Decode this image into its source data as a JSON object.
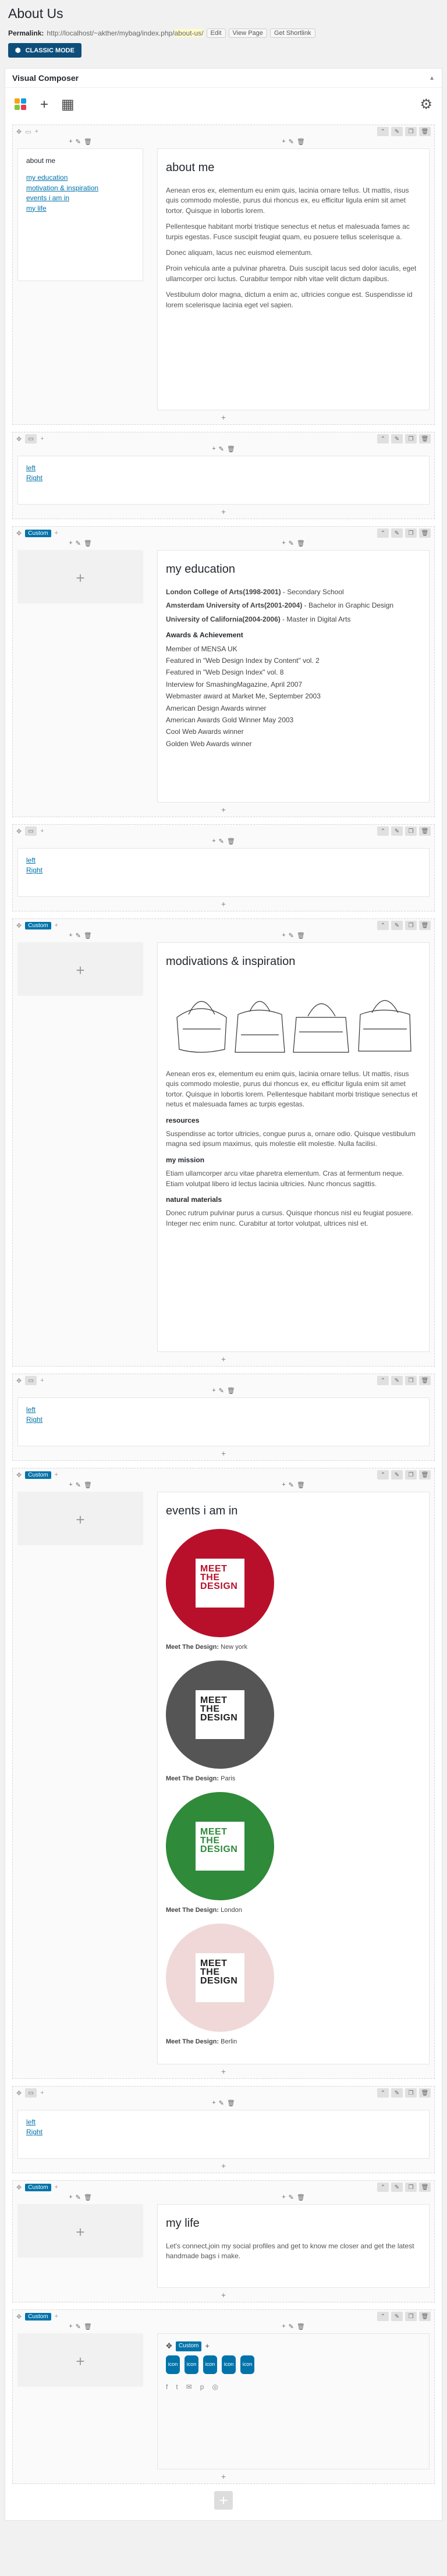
{
  "page": {
    "title": "About Us",
    "permalink_label": "Permalink:",
    "permalink_base": "http://localhost/~akther/mybag/index.php/",
    "permalink_slug": "about-us/",
    "edit_btn": "Edit",
    "view_btn": "View Page",
    "shortlink_btn": "Get Shortlink",
    "classic_mode": "CLASSIC MODE"
  },
  "vc": {
    "title": "Visual Composer",
    "toggle": "▲"
  },
  "labels": {
    "custom": "Custom"
  },
  "about": {
    "widget_title": "about me",
    "links": [
      "my education",
      "motivation & inspiration",
      "events i am in",
      "my life"
    ],
    "heading": "about me",
    "paras": [
      "Aenean eros ex, elementum eu enim quis, lacinia ornare tellus. Ut mattis, risus quis commodo molestie, purus dui rhoncus ex, eu efficitur ligula enim sit amet tortor. Quisque in lobortis lorem.",
      "Pellentesque habitant morbi tristique senectus et netus et malesuada fames ac turpis egestas. Fusce suscipit feugiat quam, eu posuere tellus scelerisque a.",
      "Donec aliquam, lacus nec euismod elementum.",
      "Proin vehicula ante a pulvinar pharetra. Duis suscipit lacus sed dolor iaculis, eget ullamcorper orci luctus. Curabitur tempor nibh vitae velit dictum dapibus.",
      "Vestibulum dolor magna, dictum a enim ac, ultricies congue est. Suspendisse id lorem scelerisque lacinia eget vel sapien."
    ]
  },
  "nav": {
    "left": "left",
    "right": "Right"
  },
  "education": {
    "heading": "my education",
    "items": [
      [
        "London College of Arts(1998-2001)",
        " - Secondary School"
      ],
      [
        "Amsterdam University of Arts(2001-2004)",
        " - Bachelor in Graphic Design"
      ],
      [
        "University of California(2004-2006)",
        " - Master in Digital Arts"
      ]
    ],
    "awards_title": "Awards & Achievement",
    "awards": [
      "Member of MENSA UK",
      "Featured in \"Web Design Index by Content\" vol. 2",
      "Featured in \"Web Design Index\" vol. 8",
      "Interview for SmashingMagazine, April 2007",
      "Webmaster award at Market Me, September 2003",
      "American Design Awards winner",
      "American Awards Gold Winner May 2003",
      "Cool Web Awards winner",
      "Golden Web Awards winner"
    ]
  },
  "motivation": {
    "heading": "modivations & inspiration",
    "paras": [
      "Aenean eros ex, elementum eu enim quis, lacinia ornare tellus. Ut mattis, risus quis commodo molestie, purus dui rhoncus ex, eu efficitur ligula enim sit amet tortor. Quisque in lobortis lorem. Pellentesque habitant morbi tristique senectus et netus et malesuada fames ac turpis egestas."
    ],
    "resources_title": "resources",
    "resources": "Suspendisse ac tortor ultricies, congue purus a, ornare odio. Quisque vestibulum magna sed ipsum maximus, quis molestie elit molestie. Nulla facilisi.",
    "mission_title": "my mission",
    "mission": "Etiam ullamcorper arcu vitae pharetra elementum. Cras at fermentum neque. Etiam volutpat libero id lectus lacinia ultricies. Nunc rhoncus sagittis.",
    "natural_title": "natural materials",
    "natural": "Donec rutrum pulvinar purus a cursus. Quisque rhoncus nisl eu feugiat posuere. Integer nec enim nunc. Curabitur at tortor volutpat, ultrices nisl et."
  },
  "events": {
    "heading": "events i am in",
    "logo_line1": "MEET",
    "logo_line2": "THE",
    "logo_line3": "DESIGN",
    "items": [
      {
        "name": "Meet The Design:",
        "city": "New york",
        "color": "#b8102b"
      },
      {
        "name": "Meet The Design:",
        "city": "Paris",
        "color": "#555555"
      },
      {
        "name": "Meet The Design:",
        "city": "London",
        "color": "#2f8a3a"
      },
      {
        "name": "Meet The Design:",
        "city": "Berlin",
        "color": "#f0d8d8"
      }
    ]
  },
  "life": {
    "heading": "my life",
    "text": "Let's connect,join my social profiles and get to know me closer and get the latest handmade bags i make."
  },
  "social": {
    "icon_label": "icon"
  }
}
